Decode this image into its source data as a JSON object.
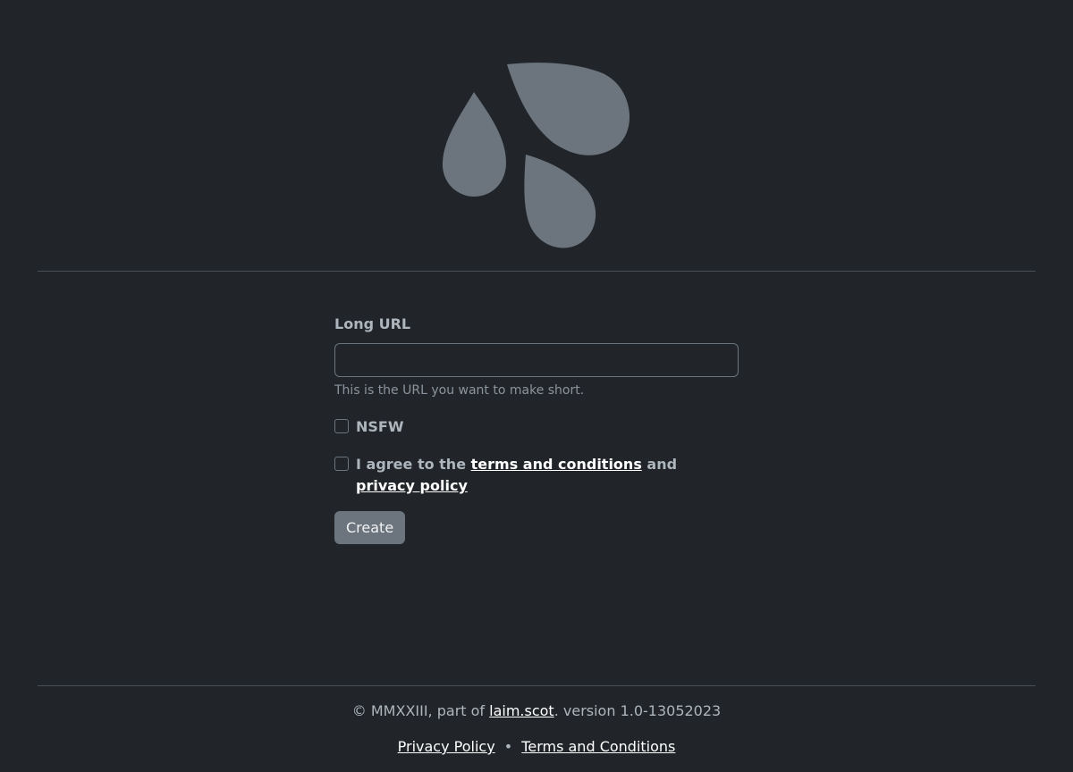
{
  "brand": {
    "logo_icon": "water-drops-icon",
    "logo_color": "#6c757d"
  },
  "form": {
    "long_url_label": "Long URL",
    "long_url_value": "",
    "long_url_placeholder": "",
    "long_url_help": "This is the URL you want to make short.",
    "nsfw_label": "NSFW",
    "agree_prefix": "I agree to the",
    "terms_link": "terms and conditions",
    "agree_middle": "and",
    "privacy_link": "privacy policy",
    "create_button": "Create"
  },
  "footer": {
    "copyright_prefix": "© MMXXIII, part of",
    "site_link": "laim.scot",
    "version_text": ". version 1.0-13052023",
    "privacy_link": "Privacy Policy",
    "separator": "•",
    "terms_link": "Terms and Conditions"
  },
  "colors": {
    "background": "#212529",
    "text_muted": "#adb5bd",
    "button_bg": "#6c757d",
    "link": "#ffffff"
  }
}
